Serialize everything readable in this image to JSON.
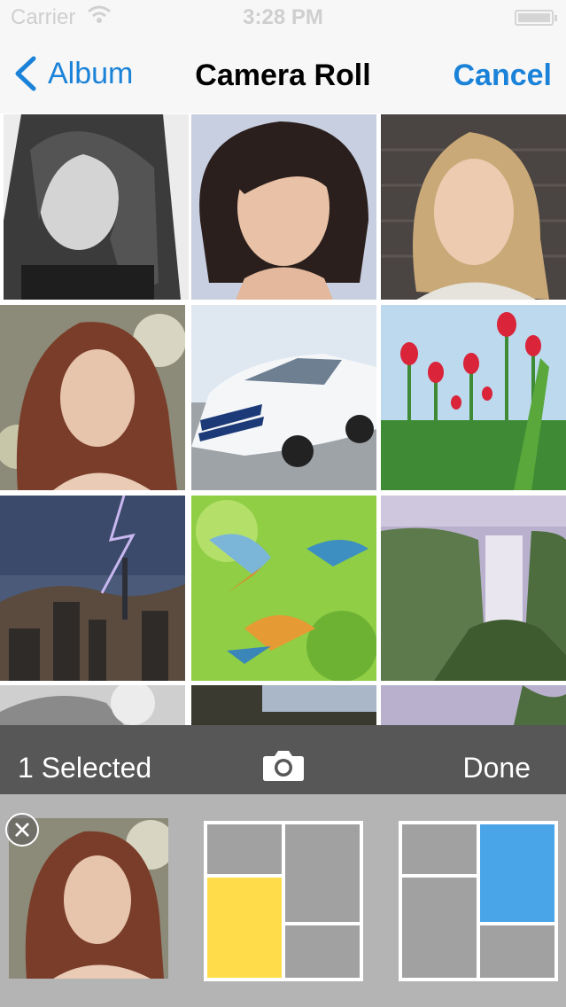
{
  "status_bar": {
    "carrier": "Carrier",
    "time": "3:28 PM",
    "wifi_icon": "wifi-icon",
    "battery_icon": "battery-icon"
  },
  "nav": {
    "back_label": "Album",
    "title": "Camera Roll",
    "cancel_label": "Cancel",
    "back_icon": "chevron-left-icon"
  },
  "photos": [
    {
      "subject": "woman-black-and-white-portrait"
    },
    {
      "subject": "woman-short-dark-hair"
    },
    {
      "subject": "woman-blonde-brick-wall"
    },
    {
      "subject": "woman-auburn-hair-looking-up"
    },
    {
      "subject": "white-sports-car"
    },
    {
      "subject": "red-tulips"
    },
    {
      "subject": "lightning-over-city"
    },
    {
      "subject": "kingfisher-birds"
    },
    {
      "subject": "waterfall"
    },
    {
      "subject": "partial-row"
    },
    {
      "subject": "partial-row"
    },
    {
      "subject": "partial-row"
    }
  ],
  "toolbar": {
    "selected_label": "1 Selected",
    "done_label": "Done",
    "camera_icon": "camera-icon"
  },
  "tray": {
    "remove_icon": "close-icon",
    "layout_1_accent": "#ffdd4a",
    "layout_2_accent": "#4aa4e8"
  },
  "colors": {
    "accent": "#1a82d8",
    "toolbar": "#575757",
    "tray": "#b4b4b4"
  }
}
